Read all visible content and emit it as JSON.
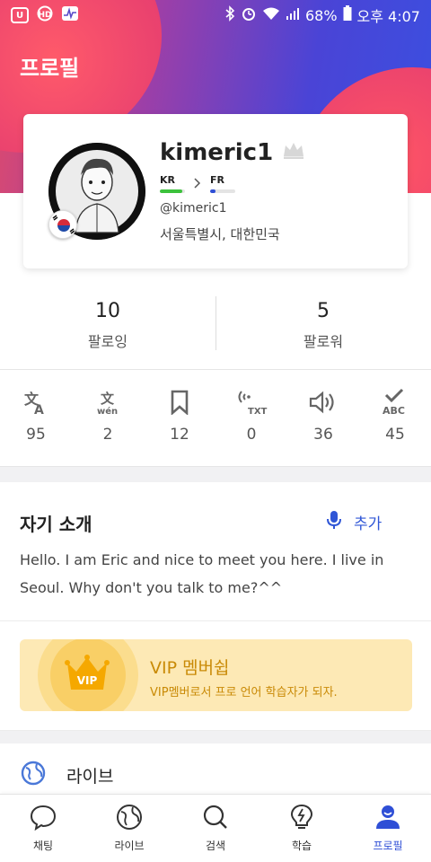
{
  "status_bar": {
    "battery": "68%",
    "time": "오후 4:07"
  },
  "header": {
    "title": "프로필"
  },
  "profile": {
    "username": "kimeric1",
    "handle": "@kimeric1",
    "location": "서울특별시, 대한민국",
    "native_language": {
      "code": "KR",
      "level": 0.9,
      "color": "#3cc23c"
    },
    "learning_language": {
      "code": "FR",
      "level": 0.2,
      "color": "#2f4fd6"
    }
  },
  "follow": {
    "following_count": "10",
    "following_label": "팔로잉",
    "followers_count": "5",
    "followers_label": "팔로워"
  },
  "activity": [
    {
      "icon": "translate-icon",
      "value": "95"
    },
    {
      "icon": "pinyin-icon",
      "value": "2"
    },
    {
      "icon": "bookmark-icon",
      "value": "12"
    },
    {
      "icon": "text-to-speech-icon",
      "value": "0"
    },
    {
      "icon": "speaker-icon",
      "value": "36"
    },
    {
      "icon": "spell-check-icon",
      "value": "45"
    }
  ],
  "intro": {
    "title": "자기 소개",
    "add_label": "추가",
    "text": "Hello. I am Eric and nice to meet you here. I live in Seoul. Why don't you talk to me?^^"
  },
  "vip": {
    "badge": "VIP",
    "title": "VIP 멤버쉽",
    "subtitle": "VIP멤버로서 프로 언어 학습자가 되자."
  },
  "live_row": {
    "label": "라이브"
  },
  "bottom_nav": [
    {
      "icon": "chat-bubble-icon",
      "label": "채팅",
      "active": false
    },
    {
      "icon": "globe-icon",
      "label": "라이브",
      "active": false
    },
    {
      "icon": "search-icon",
      "label": "검색",
      "active": false
    },
    {
      "icon": "lightbulb-icon",
      "label": "학습",
      "active": false
    },
    {
      "icon": "profile-icon",
      "label": "프로필",
      "active": true
    }
  ],
  "colors": {
    "accent": "#2f4fd6",
    "vip_background": "#fde9b5",
    "vip_text": "#c98a06"
  }
}
